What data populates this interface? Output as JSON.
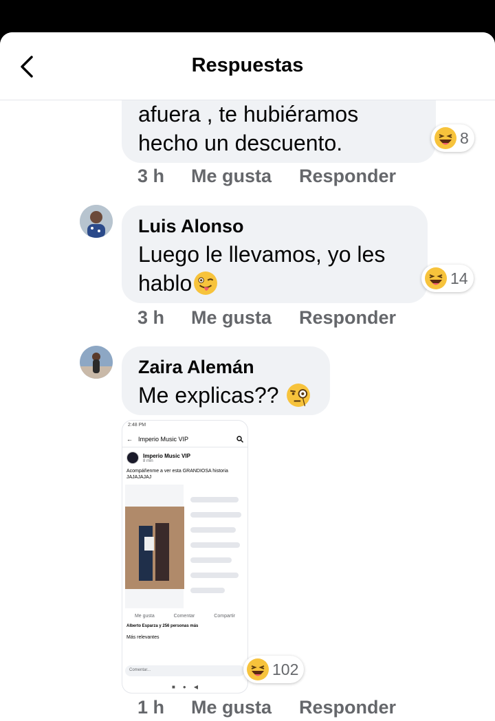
{
  "header": {
    "title": "Respuestas"
  },
  "comments": [
    {
      "author": "",
      "line1": "afuera , te hubiéramos",
      "line2": "hecho un descuento.",
      "reaction_count": "8",
      "time": "3 h",
      "like": "Me gusta",
      "reply": "Responder"
    },
    {
      "author": "Luis Alonso",
      "line1": "Luego le llevamos, yo les",
      "line2": "hablo",
      "reaction_count": "14",
      "time": "3 h",
      "like": "Me gusta",
      "reply": "Responder"
    },
    {
      "author": "Zaira Alemán",
      "line1": "Me explicas??",
      "reaction_count": "102",
      "time": "1 h",
      "like": "Me gusta",
      "reply": "Responder"
    }
  ],
  "attachment": {
    "status": "2:48 PM",
    "search_title": "Imperio Music VIP",
    "page_name": "Imperio Music VIP",
    "post_time": "8 min",
    "post_text": "Acompáñenme a ver esta GRANDIOSA historia JAJAJAJAJ",
    "like": "Me gusta",
    "comment": "Comentar",
    "share": "Compartir",
    "reactions": "Alberto Esparza y 256 personas más",
    "relevant": "Más relevantes",
    "composer": "Comentar..."
  },
  "colors": {
    "bubble": "#f0f2f5",
    "meta": "#65676b",
    "text": "#050505"
  }
}
